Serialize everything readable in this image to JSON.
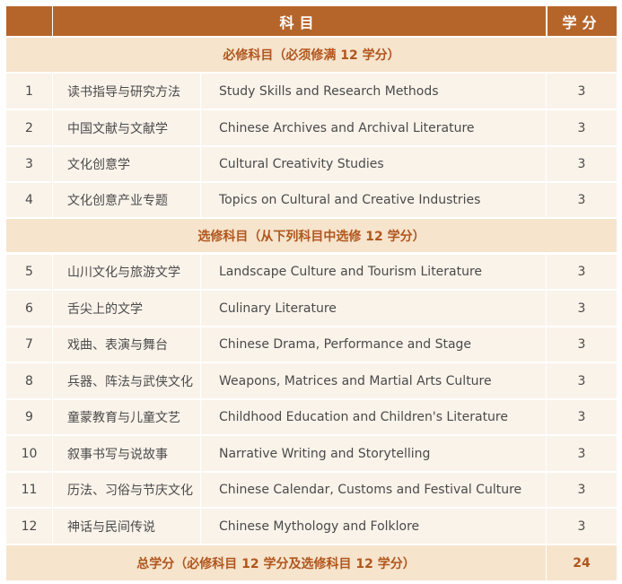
{
  "header": {
    "course_label": "科目",
    "credit_label": "学分"
  },
  "sections": [
    {
      "title": "必修科目（必须修满 12 学分）",
      "courses": [
        {
          "num": "1",
          "cn": "读书指导与研究方法",
          "en": "Study Skills and Research Methods",
          "credit": "3"
        },
        {
          "num": "2",
          "cn": "中国文献与文献学",
          "en": "Chinese Archives and Archival Literature",
          "credit": "3"
        },
        {
          "num": "3",
          "cn": "文化创意学",
          "en": "Cultural Creativity Studies",
          "credit": "3"
        },
        {
          "num": "4",
          "cn": "文化创意产业专题",
          "en": "Topics on Cultural and Creative Industries",
          "credit": "3"
        }
      ]
    },
    {
      "title": "选修科目（从下列科目中选修 12 学分）",
      "courses": [
        {
          "num": "5",
          "cn": "山川文化与旅游文学",
          "en": "Landscape Culture and Tourism Literature",
          "credit": "3"
        },
        {
          "num": "6",
          "cn": "舌尖上的文学",
          "en": "Culinary Literature",
          "credit": "3"
        },
        {
          "num": "7",
          "cn": "戏曲、表演与舞台",
          "en": "Chinese Drama, Performance and Stage",
          "credit": "3"
        },
        {
          "num": "8",
          "cn": "兵器、阵法与武侠文化",
          "en": "Weapons, Matrices and Martial Arts Culture",
          "credit": "3"
        },
        {
          "num": "9",
          "cn": "童蒙教育与儿童文艺",
          "en": "Childhood Education and Children's Literature",
          "credit": "3"
        },
        {
          "num": "10",
          "cn": "叙事书写与说故事",
          "en": "Narrative Writing and Storytelling",
          "credit": "3"
        },
        {
          "num": "11",
          "cn": "历法、习俗与节庆文化",
          "en": "Chinese Calendar, Customs and Festival Culture",
          "credit": "3"
        },
        {
          "num": "12",
          "cn": "神话与民间传说",
          "en": "Chinese Mythology and Folklore",
          "credit": "3"
        }
      ]
    }
  ],
  "total": {
    "label": "总学分（必修科目 12 学分及选修科目 12 学分）",
    "value": "24"
  },
  "colors": {
    "header_bg": "#b6652a",
    "section_bg": "#f6e4cd",
    "section_text": "#b0561d",
    "row_bg": "#faf3ea"
  }
}
